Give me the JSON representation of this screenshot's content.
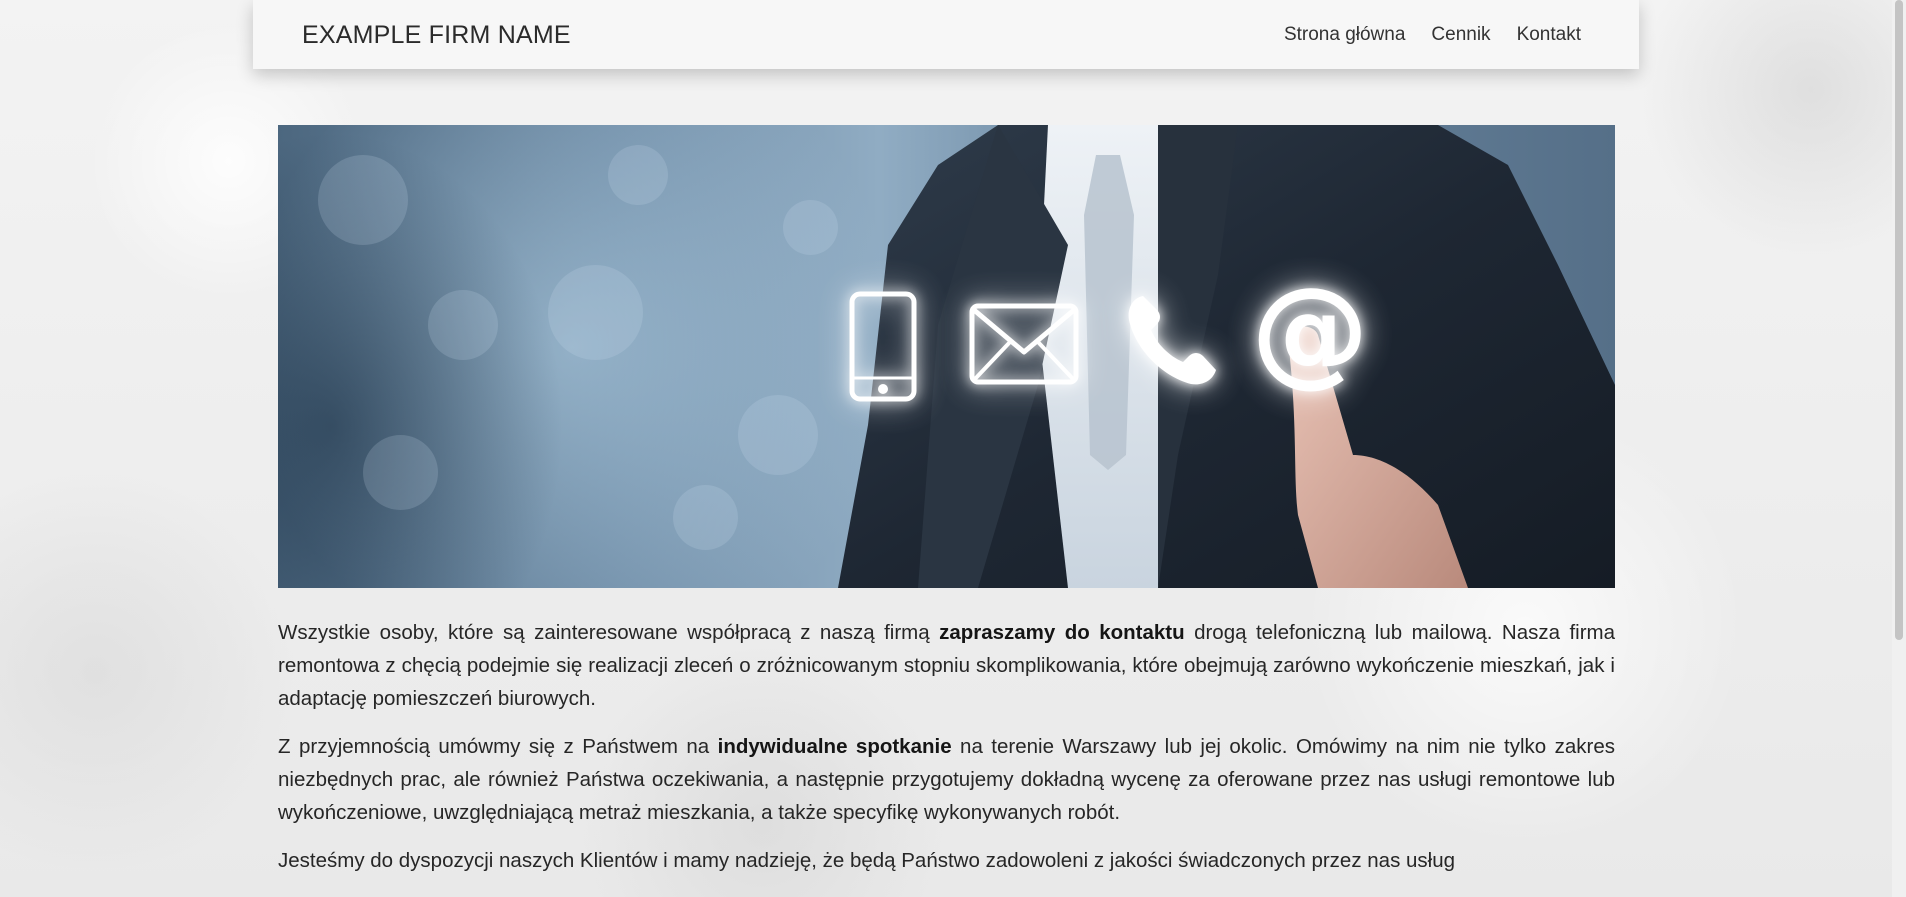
{
  "header": {
    "brand": "EXAMPLE FIRM NAME",
    "nav": [
      {
        "label": "Strona główna"
      },
      {
        "label": "Cennik"
      },
      {
        "label": "Kontakt"
      }
    ]
  },
  "hero": {
    "icons": [
      "smartphone-icon",
      "envelope-icon",
      "phone-handset-icon",
      "at-sign-icon"
    ],
    "at_glyph": "@"
  },
  "content": {
    "p1": {
      "before": "Wszystkie osoby, które są zainteresowane współpracą z naszą firmą ",
      "bold": "zapraszamy do kontaktu",
      "after": " drogą telefoniczną lub mailową. Nasza firma remontowa z chęcią podejmie się realizacji zleceń o zróżnicowanym stopniu skomplikowania, które obejmują zarówno wykończenie mieszkań, jak i adaptację pomieszczeń biurowych."
    },
    "p2": {
      "before": "Z przyjemnością umówmy się z Państwem na ",
      "bold": "indywidualne spotkanie",
      "after": " na terenie Warszawy lub jej okolic. Omówimy na nim nie tylko zakres niezbędnych prac, ale również Państwa oczekiwania, a następnie przygotujemy dokładną wycenę za oferowane przez nas usługi remontowe lub wykończeniowe, uwzględniającą metraż mieszkania, a także specyfikę wykonywanych robót."
    },
    "p3": {
      "text": "Jesteśmy do dyspozycji naszych Klientów i mamy nadzieję, że będą Państwo zadowoleni z jakości świadczonych przez nas usług"
    }
  },
  "colors": {
    "page_background": "#ededed",
    "navbar_background": "#f7f7f7",
    "text": "#262626",
    "hero_blue": "#6f8ca6"
  }
}
